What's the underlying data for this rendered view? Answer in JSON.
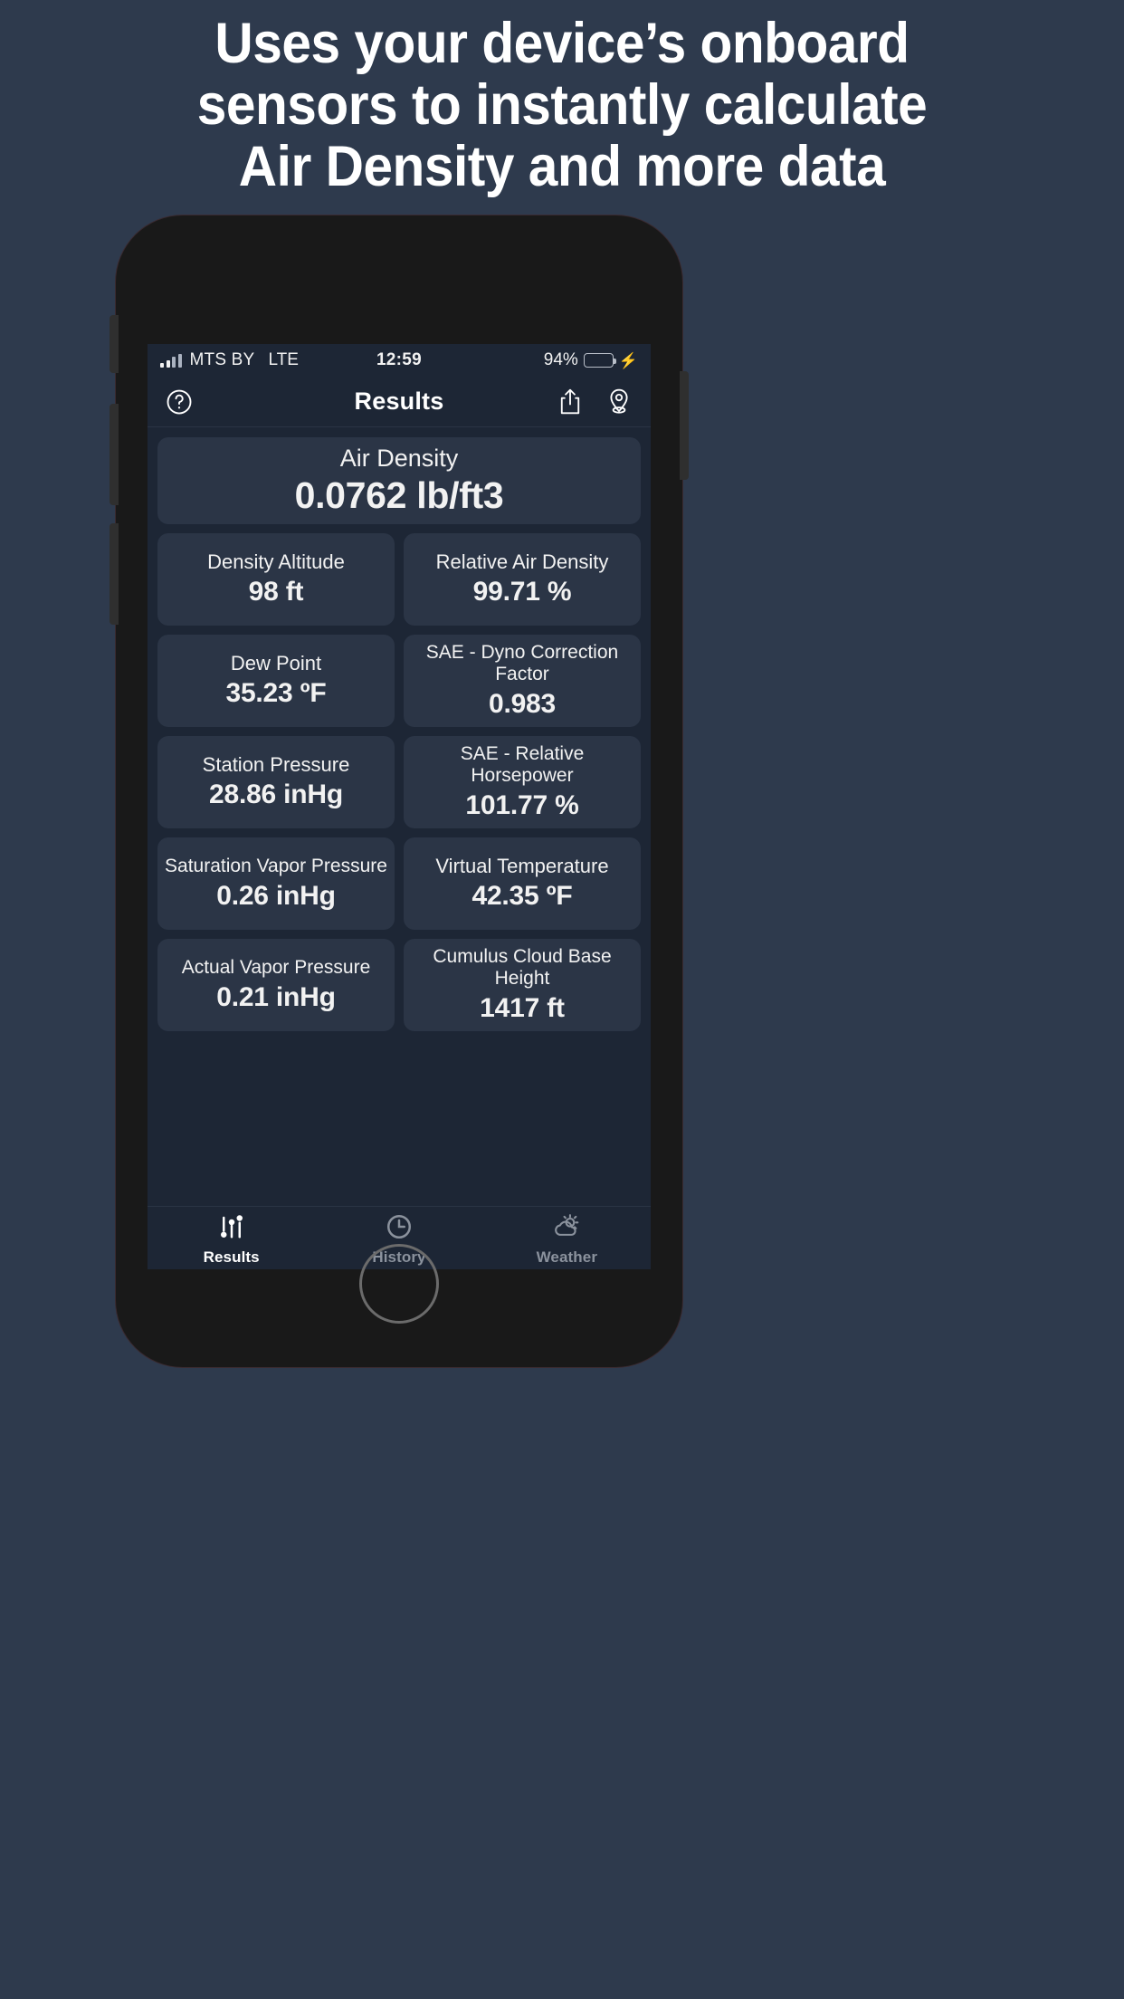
{
  "headline": {
    "lines": [
      "Uses your device’s onboard",
      "sensors to instantly calculate",
      "Air Density and more data"
    ]
  },
  "colors": {
    "page_background": "#2e3a4d",
    "screen_background": "#1d2635",
    "card_background": "#2b3546",
    "phone_frame": "#191919",
    "battery_green": "#4cd964",
    "inactive_tab": "#8b929d"
  },
  "status_bar": {
    "signal_icon": "signal-bars-icon",
    "carrier": "MTS BY",
    "network": "LTE",
    "time": "12:59",
    "battery_percent": "94%",
    "battery_icon": "battery-icon",
    "charging_icon": "lightning-bolt-icon"
  },
  "nav_bar": {
    "help_icon": "question-mark-circle-icon",
    "title": "Results",
    "share_icon": "share-icon",
    "location_icon": "location-pin-icon"
  },
  "hero_card": {
    "label": "Air Density",
    "value": "0.0762 lb/ft3"
  },
  "metrics": [
    {
      "label": "Density Altitude",
      "value": "98 ft",
      "lines": 1
    },
    {
      "label": "Relative Air Density",
      "value": "99.71 %",
      "lines": 1
    },
    {
      "label": "Dew Point",
      "value": "35.23 ºF",
      "lines": 1
    },
    {
      "label": "SAE - Dyno Correction Factor",
      "value": "0.983",
      "lines": 2
    },
    {
      "label": "Station Pressure",
      "value": "28.86 inHg",
      "lines": 1
    },
    {
      "label": "SAE - Relative Horsepower",
      "value": "101.77 %",
      "lines": 2
    },
    {
      "label": "Saturation Vapor Pressure",
      "value": "0.26 inHg",
      "lines": 2
    },
    {
      "label": "Virtual Temperature",
      "value": "42.35 ºF",
      "lines": 1
    },
    {
      "label": "Actual Vapor Pressure",
      "value": "0.21 inHg",
      "lines": 2
    },
    {
      "label": "Cumulus Cloud Base Height",
      "value": "1417 ft",
      "lines": 2
    }
  ],
  "tab_bar": {
    "tabs": [
      {
        "label": "Results",
        "icon": "sliders-icon",
        "active": true
      },
      {
        "label": "History",
        "icon": "clock-icon",
        "active": false
      },
      {
        "label": "Weather",
        "icon": "sun-cloud-icon",
        "active": false
      }
    ]
  },
  "home_button": {
    "name": "home-button"
  }
}
